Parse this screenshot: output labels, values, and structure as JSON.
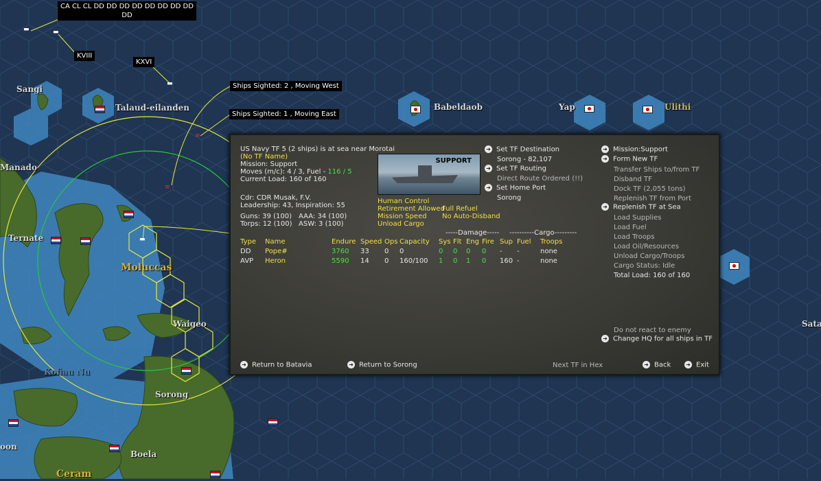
{
  "map": {
    "sea_color": "#1f3552",
    "labels": {
      "tf_composition": "CA CL CL DD DD DD DD DD DD DD DD",
      "tf_composition_2": "DD",
      "kviii": "KVIII",
      "kxvi": "KXVI",
      "sighting_1": "Ships Sighted: 2 , Moving West",
      "sighting_2": "Ships Sighted: 1 , Moving East"
    },
    "places": {
      "sangi": "Sangi",
      "talaud": "Talaud-eilanden",
      "manado": "Manado",
      "ternate": "Ternate",
      "moluccas": "Moluccas",
      "waigeo": "Waigeo",
      "kofiau": "Kofiau Nu",
      "sorong": "Sorong",
      "boela": "Boela",
      "ceram": "Ceram",
      "babeldaob": "Babeldaob",
      "yap": "Yap",
      "ulithi": "Ulithi",
      "satawal": "Sata",
      "amboon": "oon"
    }
  },
  "panel": {
    "header": {
      "tf_line": "US Navy TF 5 (2 ships) is at sea near Morotai",
      "tf_name": "(No TF Name)",
      "mission": "Mission: Support",
      "moves_prefix": "Moves (m/c): 4 / 3, Fuel - ",
      "moves_fuel": "116 / 5",
      "current_load": "Current Load:  160 of 160",
      "cdr": "Cdr: CDR  Musak, F.V.",
      "leadership": "Leadership: 43, Inspiration: 55",
      "guns": "Guns: 39 (100)",
      "aaa": "AAA: 34 (100)",
      "torps": "Torps: 12 (100)",
      "asw": "ASW: 3 (100)"
    },
    "picture_label": "SUPPORT",
    "options": {
      "human_control": "Human Control",
      "retirement": "Retirement Allowed",
      "full_refuel": "Full Refuel",
      "mission_speed": "Mission Speed",
      "no_auto_disband": "No Auto-Disband",
      "unload_cargo": "Unload Cargo"
    },
    "routing": {
      "set_destination": "Set TF Destination",
      "destination_value": "Sorong - 82,107",
      "set_routing": "Set TF Routing",
      "routing_value": "Direct Route Ordered (!!)",
      "set_home": "Set Home Port",
      "home_value": "Sorong"
    },
    "right_menu": {
      "mission": "Mission:Support",
      "form_new": "Form New TF",
      "transfer": "Transfer Ships to/from TF",
      "disband": "Disband TF",
      "dock": "Dock TF (2,055 tons)",
      "replenish_port": "Replenish TF from Port",
      "replenish_sea": "Replenish TF at Sea",
      "load_supplies": "Load Supplies",
      "load_fuel": "Load Fuel",
      "load_troops": "Load Troops",
      "load_oil": "Load Oil/Resources",
      "unload_cargo_troops": "Unload Cargo/Troops",
      "cargo_status": "Cargo Status: Idle",
      "total_load": "Total Load: 160 of 160",
      "do_not_react": "Do not react to enemy",
      "change_hq": "Change HQ for all ships in TF"
    },
    "table": {
      "group_damage": "-----Damage-----",
      "group_cargo": "----------Cargo---------",
      "headers": [
        "Type",
        "Name",
        "Endure",
        "Speed",
        "Ops",
        "Capacity",
        "Sys",
        "Flt",
        "Eng",
        "Fire",
        "Sup",
        "Fuel",
        "Troops"
      ],
      "rows": [
        [
          "DD",
          "Pope#",
          "3760",
          "33",
          "0",
          "0",
          "0",
          "0",
          "0",
          "0",
          "-",
          "-",
          "none"
        ],
        [
          "AVP",
          "Heron",
          "5590",
          "14",
          "0",
          "160/100",
          "1",
          "0",
          "1",
          "0",
          "160",
          "-",
          "none"
        ]
      ]
    },
    "bottom": {
      "return_batavia": "Return to Batavia",
      "return_sorong": "Return to Sorong",
      "next_tf": "Next TF in Hex",
      "back": "Back",
      "exit": "Exit"
    }
  }
}
